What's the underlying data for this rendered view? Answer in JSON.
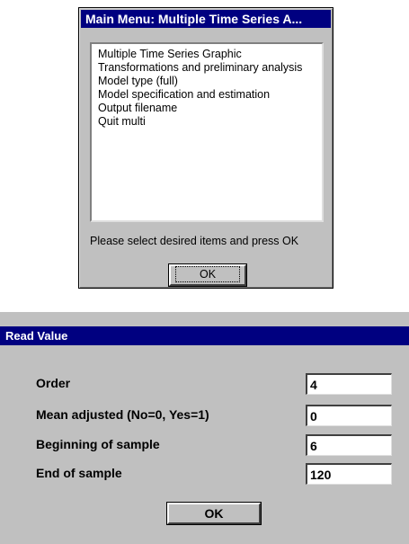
{
  "main_menu": {
    "title": "Main Menu: Multiple Time Series A...",
    "items": [
      "Multiple Time Series Graphic",
      "Transformations and preliminary analysis",
      "Model type (full)",
      "Model specification and estimation",
      "Output filename",
      "Quit multi"
    ],
    "prompt": "Please select desired items and press OK",
    "ok_label": "OK"
  },
  "read_value": {
    "title": "Read Value",
    "fields": [
      {
        "label": "Order",
        "value": "4"
      },
      {
        "label": "Mean adjusted (No=0, Yes=1)",
        "value": "0"
      },
      {
        "label": "Beginning of sample",
        "value": "6"
      },
      {
        "label": "End of sample",
        "value": "120"
      }
    ],
    "ok_label": "OK"
  },
  "colors": {
    "titlebar": "#000080",
    "face": "#c0c0c0",
    "field": "#ffffff"
  }
}
